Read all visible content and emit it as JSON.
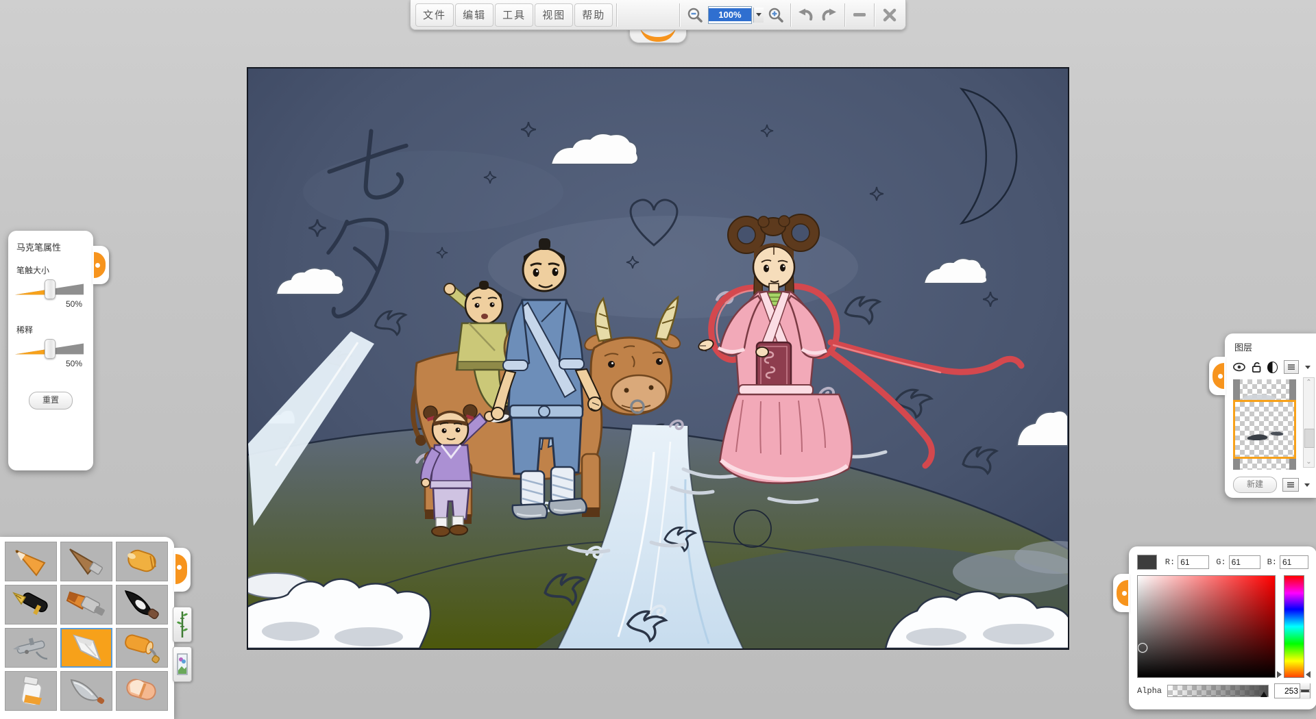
{
  "app": {
    "background_color": "#c4c4c4",
    "accent_color": "#f7941d"
  },
  "toolbar": {
    "menus": [
      {
        "label": "文件"
      },
      {
        "label": "编辑"
      },
      {
        "label": "工具"
      },
      {
        "label": "视图"
      },
      {
        "label": "帮助"
      }
    ],
    "zoom": {
      "value": "100%"
    },
    "icons": [
      "logo-eye-left",
      "logo-eye-right",
      "zoom-out",
      "zoom-in",
      "undo",
      "redo",
      "minimize",
      "close"
    ]
  },
  "marker_panel": {
    "title": "马克笔属性",
    "sliders": [
      {
        "label": "笔触大小",
        "value": "50%",
        "percent": 50
      },
      {
        "label": "稀释",
        "value": "50%",
        "percent": 50
      }
    ],
    "reset_label": "重置",
    "accent_color": "#f7a11a"
  },
  "tool_palette": {
    "selected_tool": "marker",
    "selected_color": "#f7a11a",
    "selected_border": "#5b9bd5",
    "tools": [
      {
        "name": "pencil"
      },
      {
        "name": "brush-pen"
      },
      {
        "name": "crayon"
      },
      {
        "name": "fountain-pen"
      },
      {
        "name": "flat-brush"
      },
      {
        "name": "ink-brush"
      },
      {
        "name": "airbrush"
      },
      {
        "name": "marker",
        "selected": true
      },
      {
        "name": "paint-roller"
      },
      {
        "name": "paint-tube"
      },
      {
        "name": "palette-knife"
      },
      {
        "name": "eraser"
      }
    ],
    "side_buttons": [
      "bamboo-stamp",
      "picture-stamp"
    ]
  },
  "layers_panel": {
    "title": "图层",
    "toolbar_icons": [
      "visibility-eye",
      "unlock",
      "blend-half-circle",
      "layer-menu"
    ],
    "selected_layer_index": 1,
    "selection_color": "#f7a11a",
    "new_button_label": "新建"
  },
  "color_picker": {
    "r_label": "R:",
    "g_label": "G:",
    "b_label": "B:",
    "r": "61",
    "g": "61",
    "b": "61",
    "alpha_label": "Alpha",
    "alpha": "253",
    "swatch_color": "#3d3d3d",
    "hue_position": "red-bottom"
  },
  "canvas": {
    "zoom": "100%",
    "sketch_text_1": "七",
    "sketch_text_2": "夕",
    "scene": "Qixi night scene: cowherd with two children and an ox meet the weaver girl across the milky-way river, with magpies, clouds and crescent moon",
    "sky_color": "#4c5873",
    "ground_color": "#5a6678",
    "river_color": "#d9e8f5"
  }
}
